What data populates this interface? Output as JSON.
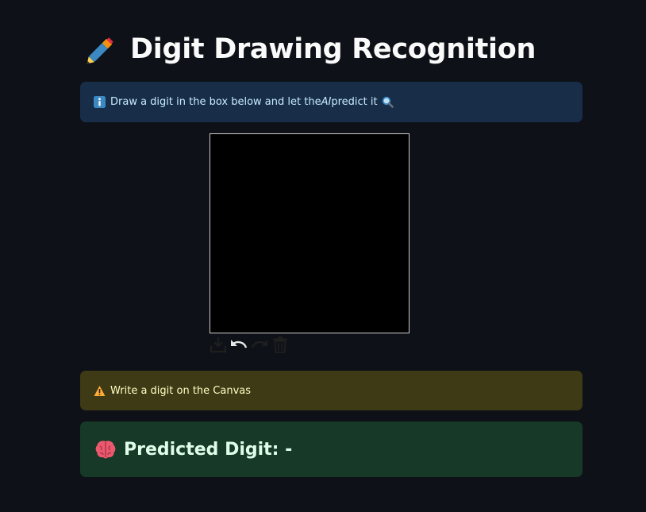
{
  "app": {
    "title": "Digit Drawing Recognition",
    "title_icon": "pen-icon"
  },
  "info": {
    "icon": "info-icon",
    "text_before": "Draw a digit in the box below and let the ",
    "text_em": "AI",
    "text_after": " predict it",
    "trail_icon": "magnifier-icon"
  },
  "canvas": {
    "background": "#000000",
    "toolbar": [
      "download-icon",
      "undo-icon",
      "redo-icon",
      "trash-icon"
    ]
  },
  "warning": {
    "icon": "warning-icon",
    "text": "Write a digit on the Canvas"
  },
  "prediction": {
    "icon": "brain-icon",
    "label": "Predicted Digit: -"
  },
  "colors": {
    "background": "#0e1117",
    "info_bg": "#172d48",
    "warning_bg": "#3e3a16",
    "success_bg": "#173928"
  }
}
